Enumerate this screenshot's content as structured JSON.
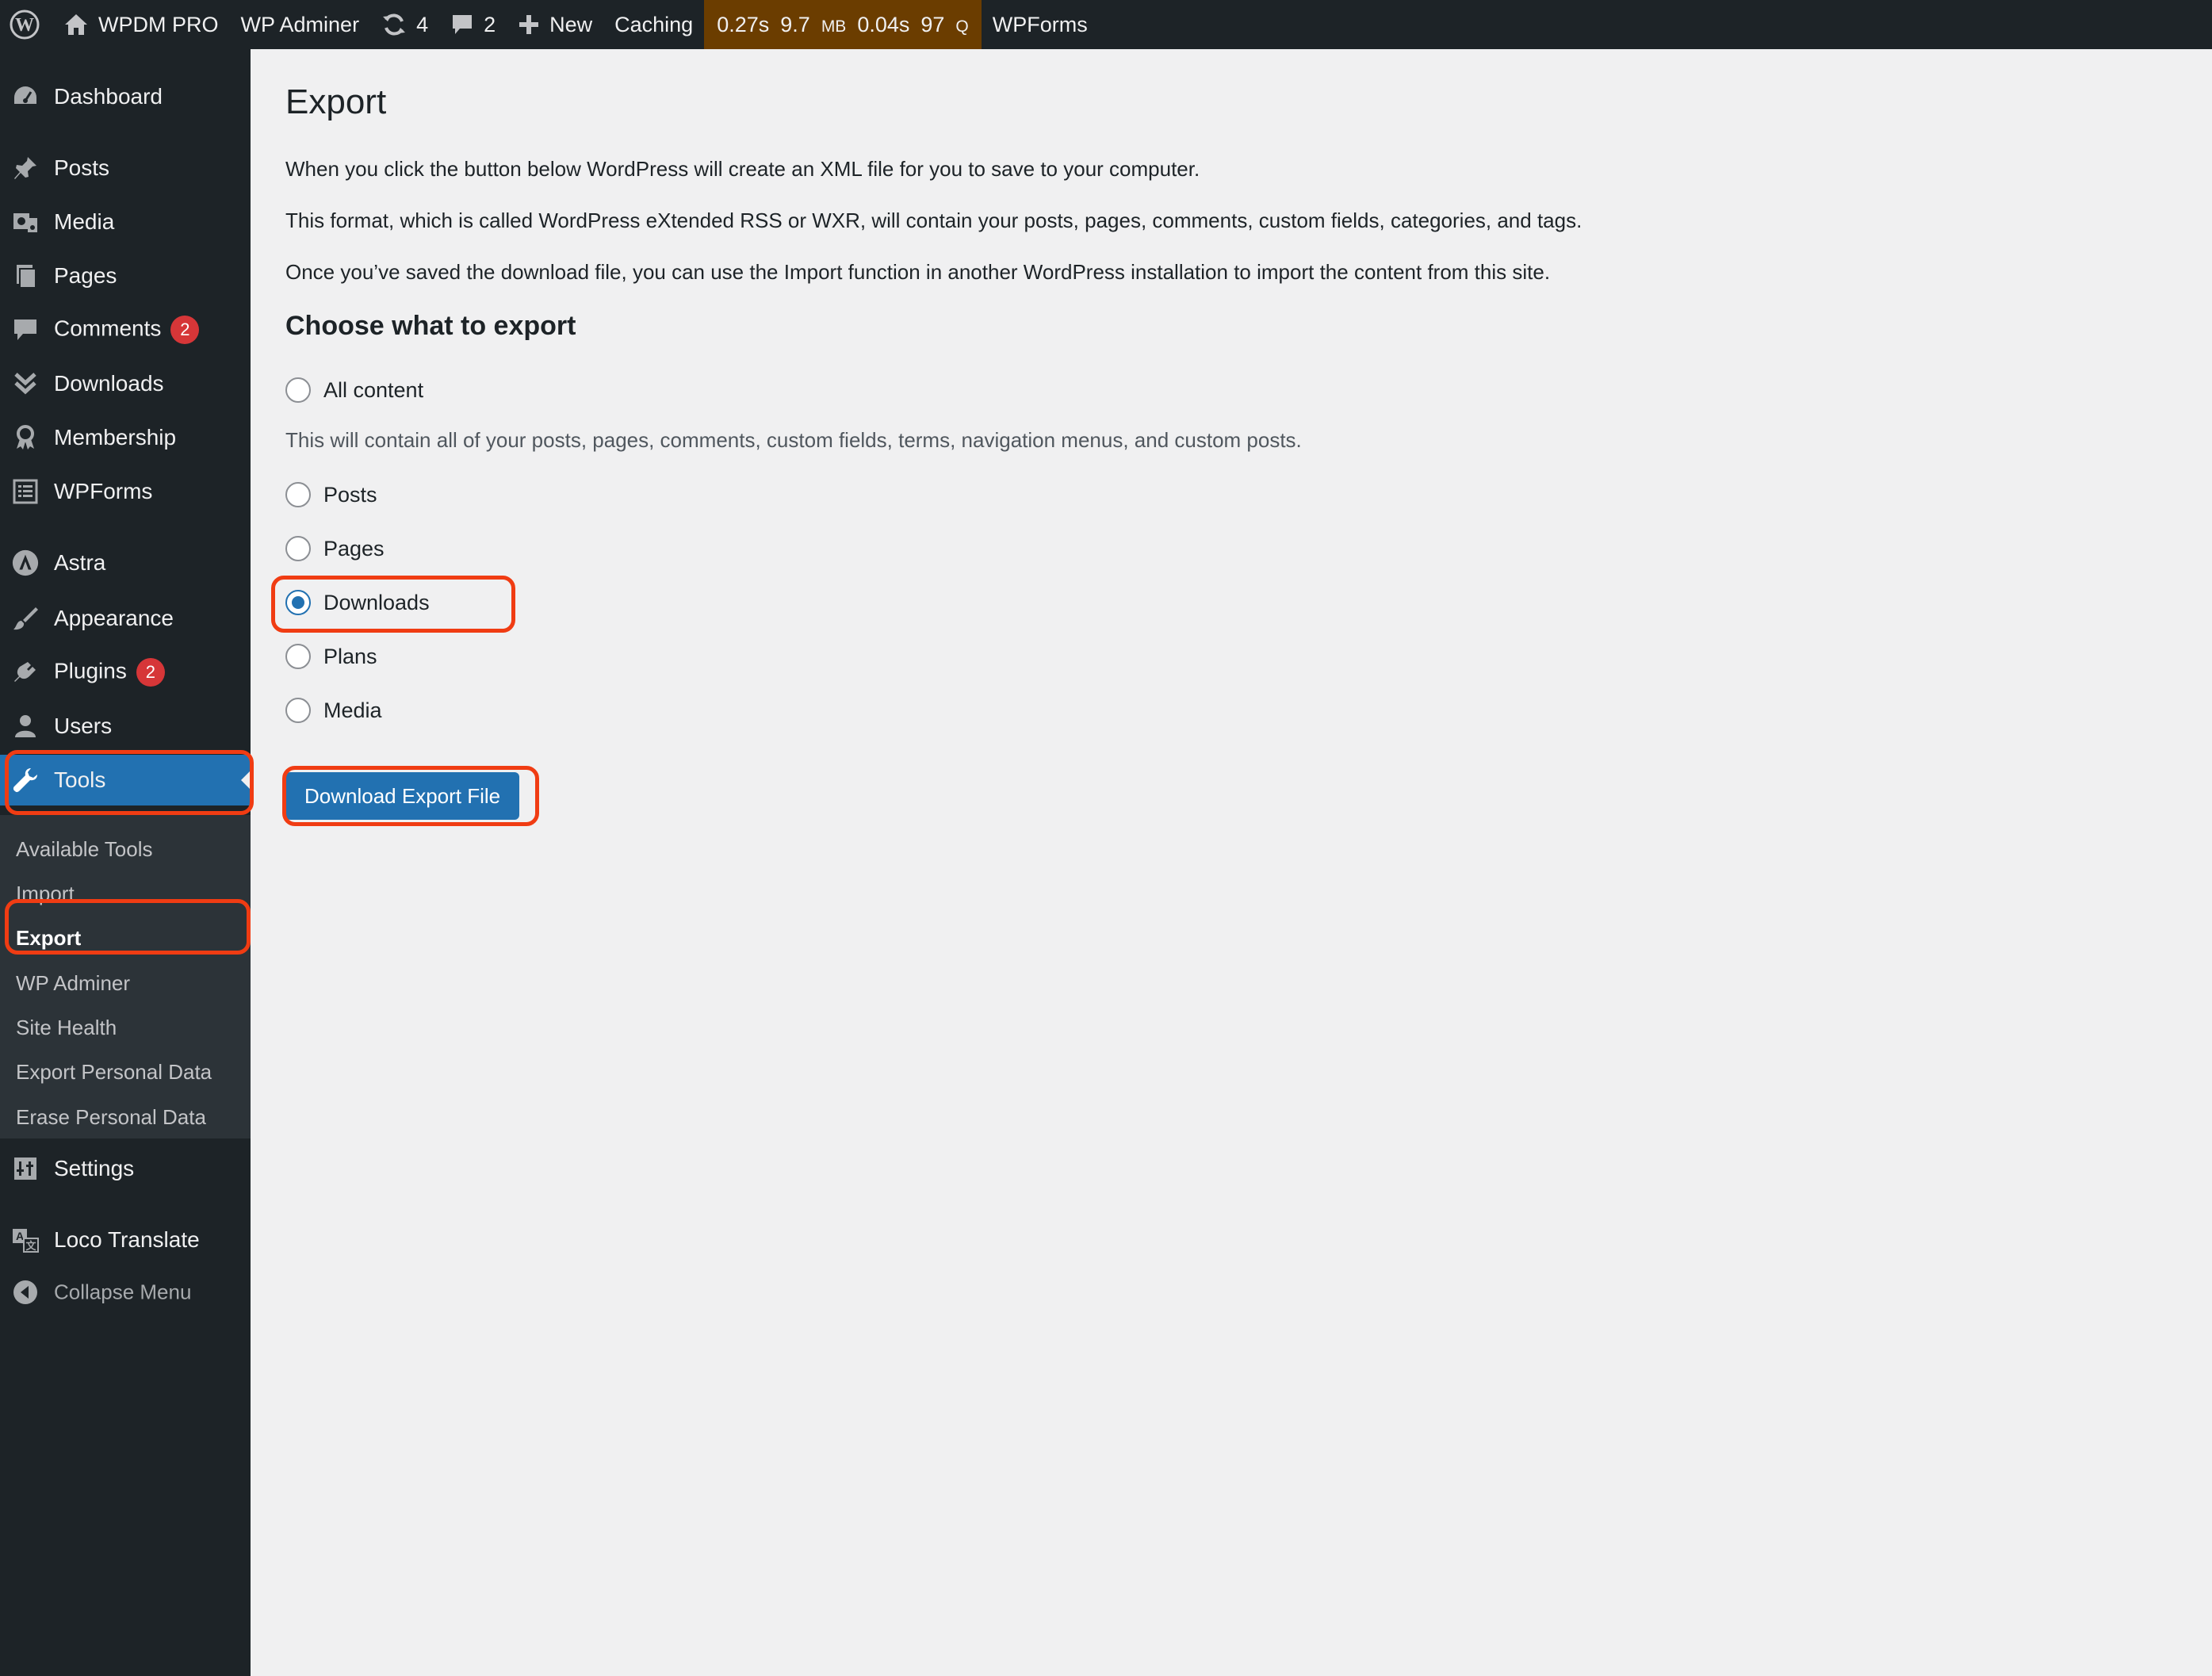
{
  "admin_bar": {
    "site_name": "WPDM PRO",
    "wp_adminer": "WP Adminer",
    "updates_count": "4",
    "comments_count": "2",
    "new_label": "New",
    "caching_label": "Caching",
    "perf": {
      "time": "0.27s",
      "memory_value": "9.7",
      "memory_unit": "MB",
      "query_time": "0.04s",
      "query_value": "97",
      "query_unit": "Q"
    },
    "wpforms_label": "WPForms",
    "perf_bg_color": "#6b3d00"
  },
  "sidebar": {
    "items": [
      {
        "label": "Dashboard",
        "icon": "dashboard-icon"
      },
      {
        "label": "Posts",
        "icon": "pin-icon"
      },
      {
        "label": "Media",
        "icon": "media-icon"
      },
      {
        "label": "Pages",
        "icon": "pages-icon"
      },
      {
        "label": "Comments",
        "icon": "comment-icon",
        "badge": "2"
      },
      {
        "label": "Downloads",
        "icon": "downloads-icon"
      },
      {
        "label": "Membership",
        "icon": "membership-icon"
      },
      {
        "label": "WPForms",
        "icon": "wpforms-icon"
      },
      {
        "label": "Astra",
        "icon": "astra-icon"
      },
      {
        "label": "Appearance",
        "icon": "brush-icon"
      },
      {
        "label": "Plugins",
        "icon": "plugin-icon",
        "badge": "2"
      },
      {
        "label": "Users",
        "icon": "users-icon"
      },
      {
        "label": "Tools",
        "icon": "wrench-icon",
        "current": true
      },
      {
        "label": "Settings",
        "icon": "settings-icon"
      },
      {
        "label": "Loco Translate",
        "icon": "translate-icon"
      },
      {
        "label": "Collapse Menu",
        "icon": "collapse-icon"
      }
    ],
    "submenu": [
      {
        "label": "Available Tools"
      },
      {
        "label": "Import"
      },
      {
        "label": "Export",
        "current": true
      },
      {
        "label": "WP Adminer"
      },
      {
        "label": "Site Health"
      },
      {
        "label": "Export Personal Data"
      },
      {
        "label": "Erase Personal Data"
      }
    ],
    "bg_color": "#1d2327",
    "current_color": "#2271b1"
  },
  "main": {
    "title": "Export",
    "paragraphs": [
      "When you click the button below WordPress will create an XML file for you to save to your computer.",
      "This format, which is called WordPress eXtended RSS or WXR, will contain your posts, pages, comments, custom fields, categories, and tags.",
      "Once you’ve saved the download file, you can use the Import function in another WordPress installation to import the content from this site."
    ],
    "choose_heading": "Choose what to export",
    "options": [
      {
        "label": "All content",
        "checked": false
      },
      {
        "label": "Posts",
        "checked": false
      },
      {
        "label": "Pages",
        "checked": false
      },
      {
        "label": "Downloads",
        "checked": true
      },
      {
        "label": "Plans",
        "checked": false
      },
      {
        "label": "Media",
        "checked": false
      }
    ],
    "all_content_description": "This will contain all of your posts, pages, comments, custom fields, terms, navigation menus, and custom posts.",
    "export_button": "Download Export File",
    "highlight_color": "#f03c13"
  }
}
